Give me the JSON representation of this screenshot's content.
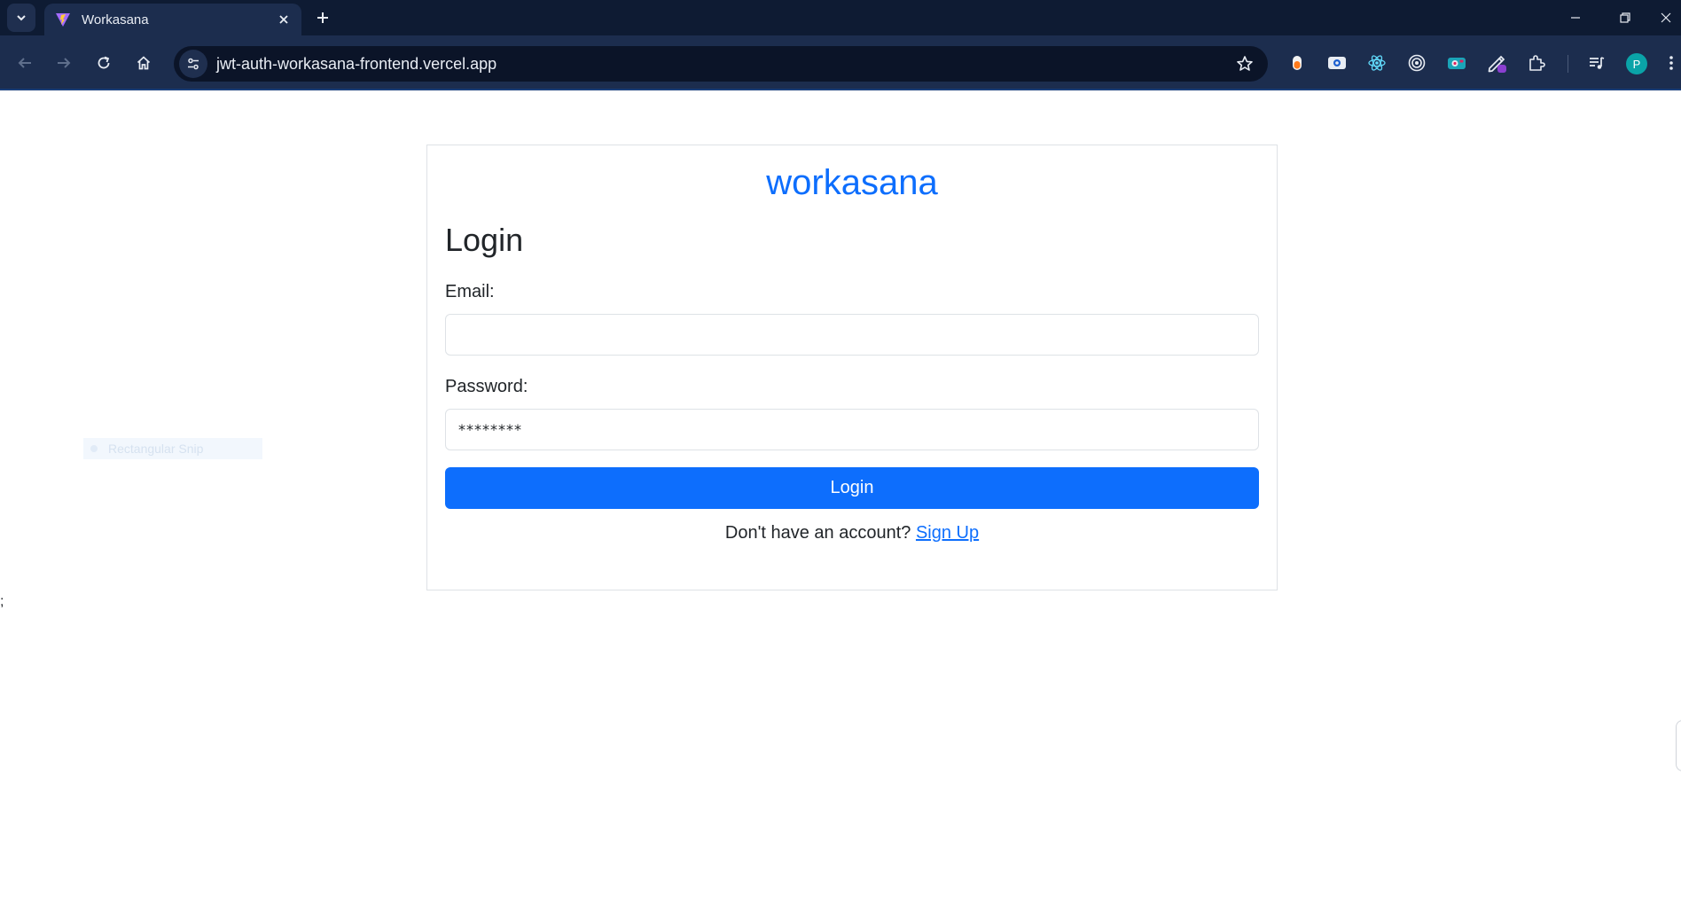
{
  "browser": {
    "tab": {
      "title": "Workasana"
    },
    "url": "jwt-auth-workasana-frontend.vercel.app",
    "avatar_initial": "P",
    "extensions": [
      "orange-pill-extension-icon",
      "screenshot-extension-icon",
      "react-devtools-icon",
      "target-extension-icon",
      "camera-extension-icon",
      "pen-extension-icon",
      "puzzle-extensions-icon"
    ]
  },
  "page": {
    "brand": "workasana",
    "heading": "Login",
    "email": {
      "label": "Email:",
      "value": ""
    },
    "password": {
      "label": "Password:",
      "value": "********"
    },
    "login_button": "Login",
    "signup": {
      "prompt": "Don't have an account?",
      "link": "Sign Up"
    },
    "snip_overlay": "Rectangular Snip",
    "stray_text": ";"
  },
  "colors": {
    "primary": "#0d6efd",
    "tabstrip": "#0e1b33",
    "toolbar": "#1c2d4e"
  }
}
